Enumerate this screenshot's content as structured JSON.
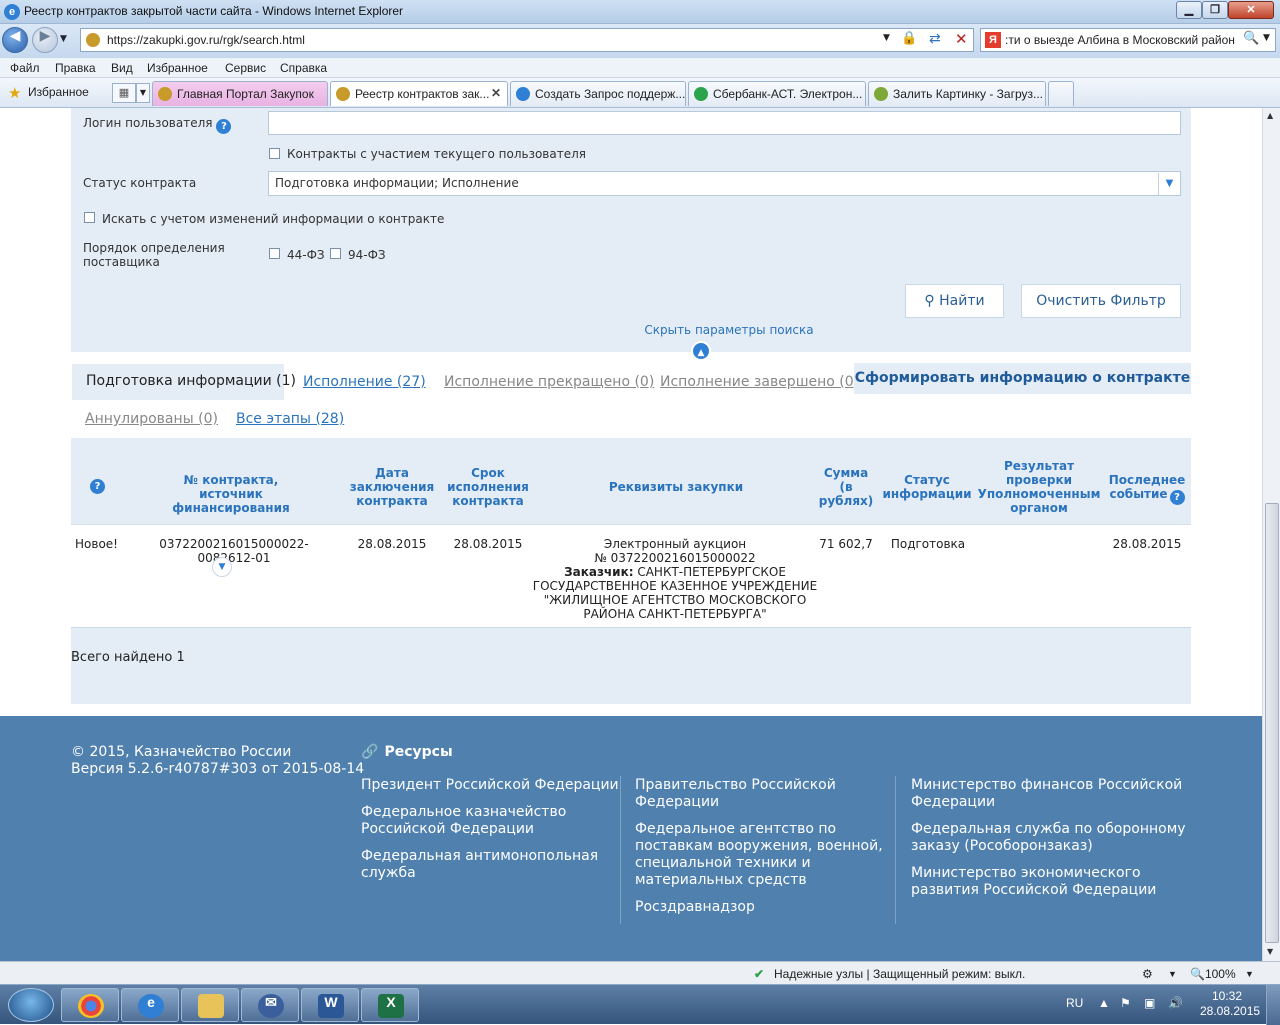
{
  "window": {
    "title": "Реестр контрактов закрытой части сайта - Windows Internet Explorer",
    "buttons": {
      "minimize": "▁",
      "maximize": "❐",
      "close": "✕"
    }
  },
  "nav": {
    "url": "https://zakupki.gov.ru/rgk/search.html",
    "search_text": ":ти о выезде Албина в Московский район",
    "search_engine_logo": "Я"
  },
  "menu": [
    "Файл",
    "Правка",
    "Вид",
    "Избранное",
    "Сервис",
    "Справка"
  ],
  "favorites": {
    "label": "Избранное"
  },
  "tabs": [
    {
      "label": "Главная Портал Закупок",
      "icon_color": "#c79a2a"
    },
    {
      "label": "Реестр контрактов закрытой части сайта",
      "display": "Реестр контрактов зак...",
      "icon_color": "#c79a2a"
    },
    {
      "label": "Создать Запрос поддерж...",
      "icon_color": "#2f7fd4"
    },
    {
      "label": "Сбербанк-АСТ. Электрон...",
      "icon_color": "#2aa34a"
    },
    {
      "label": "Залить Картинку - Загруз...",
      "icon_color": "#7fa83b"
    }
  ],
  "filters": {
    "login_label": "Логин пользователя",
    "login_value": "",
    "own_contracts_label": "Контракты с участием текущего пользователя",
    "status_label": "Статус контракта",
    "status_value": "Подготовка информации; Исполнение",
    "search_changes_label": "Искать с учетом изменений информации о контракте",
    "order_label_line1": "Порядок определения",
    "order_label_line2": "поставщика",
    "law44": "44-ФЗ",
    "law94": "94-ФЗ",
    "find_button": "Найти",
    "clear_button": "Очистить Фильтр",
    "hide_link": "Скрыть параметры поиска"
  },
  "status_tabs": {
    "prep": "Подготовка информации (1)",
    "exec": "Исполнение (27)",
    "stopped": "Исполнение прекращено (0)",
    "done": "Исполнение завершено (0)",
    "annulled": "Аннулированы (0)",
    "all": "Все этапы (28)",
    "form_button": "Сформировать информацию о контракте"
  },
  "table": {
    "headers": {
      "contract_no_l1": "№ контракта, источник",
      "contract_no_l2": "финансирования",
      "date_l1": "Дата",
      "date_l2": "заключения",
      "date_l3": "контракта",
      "term_l1": "Срок",
      "term_l2": "исполнения",
      "term_l3": "контракта",
      "details": "Реквизиты закупки",
      "sum_l1": "Сумма",
      "sum_l2": "(в",
      "sum_l3": "рублях)",
      "status_l1": "Статус",
      "status_l2": "информации",
      "check_l1": "Результат",
      "check_l2": "проверки",
      "check_l3": "Уполномоченным",
      "check_l4": "органом",
      "last_l1": "Последнее",
      "last_l2": "событие"
    },
    "rows": [
      {
        "flag": "Новое!",
        "contract_no": "0372200216015000022-0082612-01",
        "date": "28.08.2015",
        "term": "28.08.2015",
        "details_l1": "Электронный аукцион",
        "details_l2": "№ 0372200216015000022",
        "customer_label": "Заказчик:",
        "details_l3": " САНКТ-ПЕТЕРБУРГСКОЕ",
        "details_l4": "ГОСУДАРСТВЕННОЕ КАЗЕННОЕ УЧРЕЖДЕНИЕ",
        "details_l5": "\"ЖИЛИЩНОЕ АГЕНТСТВО МОСКОВСКОГО",
        "details_l6": "РАЙОНА САНКТ-ПЕТЕРБУРГА\"",
        "sum": "71 602,7",
        "status": "Подготовка",
        "check": "",
        "last_event": "28.08.2015"
      }
    ],
    "total": "Всего найдено 1"
  },
  "footer": {
    "copyright": "© 2015, Казначейство России",
    "version": "Версия 5.2.6-r40787#303 от 2015-08-14",
    "resources_title": "Ресурсы",
    "col1": [
      [
        "Президент Российской Федерации"
      ],
      [
        "Федеральное казначейство",
        "Российской Федерации"
      ],
      [
        "Федеральная антимонопольная",
        "служба"
      ]
    ],
    "col2": [
      [
        "Правительство Российской",
        "Федерации"
      ],
      [
        "Федеральное агентство по",
        "поставкам вооружения, военной,",
        "специальной техники и",
        "материальных средств"
      ],
      [
        "Росздравнадзор"
      ]
    ],
    "col3": [
      [
        "Министерство финансов Российской",
        "Федерации"
      ],
      [
        "Федеральная служба по оборонному",
        "заказу (Рособоронзаказ)"
      ],
      [
        "Министерство экономического",
        "развития Российской Федерации"
      ]
    ]
  },
  "statusbar": {
    "zone": "Надежные узлы | Защищенный режим: выкл.",
    "zoom": "100%"
  },
  "taskbar": {
    "lang": "RU",
    "time": "10:32",
    "date": "28.08.2015",
    "apps": [
      "chrome",
      "internet-explorer",
      "file-explorer",
      "thunderbird",
      "word",
      "excel"
    ]
  }
}
